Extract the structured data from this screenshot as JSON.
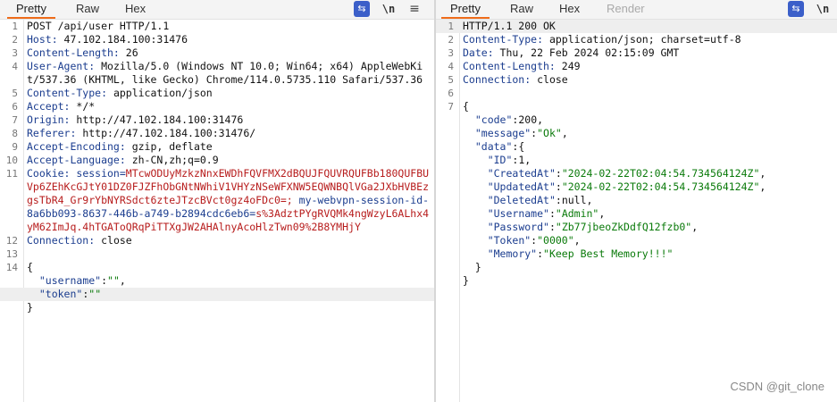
{
  "request": {
    "tabs": [
      "Pretty",
      "Raw",
      "Hex"
    ],
    "wrap_icon": "⇆",
    "newline_icon": "\\n",
    "menu_icon": "≡",
    "lines": [
      {
        "n": "1",
        "text": "POST /api/user HTTP/1.1"
      },
      {
        "n": "2",
        "k": "Host:",
        "v": " 47.102.184.100:31476"
      },
      {
        "n": "3",
        "k": "Content-Length:",
        "v": " 26"
      },
      {
        "n": "4",
        "k": "User-Agent:",
        "v": " Mozilla/5.0 (Windows NT 10.0; Win64; x64) AppleWebKit/537.36 (KHTML, like Gecko) Chrome/114.0.5735.110 Safari/537.36"
      },
      {
        "n": "5",
        "k": "Content-Type:",
        "v": " application/json"
      },
      {
        "n": "6",
        "k": "Accept:",
        "v": " */*"
      },
      {
        "n": "7",
        "k": "Origin:",
        "v": " http://47.102.184.100:31476"
      },
      {
        "n": "8",
        "k": "Referer:",
        "v": " http://47.102.184.100:31476/"
      },
      {
        "n": "9",
        "k": "Accept-Encoding:",
        "v": " gzip, deflate"
      },
      {
        "n": "10",
        "k": "Accept-Language:",
        "v": " zh-CN,zh;q=0.9"
      },
      {
        "n": "11",
        "cookie": true,
        "k": "Cookie:",
        "a": " session=",
        "b": "MTcwODUyMzkzNnxEWDhFQVFMX2dBQUJFQUVRQUFBb180QUFBUVp6ZEhKcGJtY01DZ0FJZFhObGNtNWhiV1VHYzNSeWFXNW5EQWNBQlVGa2JXbHVBEzgsTbR4_Gr9rYbNYRSdct6zteJTzcBVct0gz4oFDc0=;",
        "c": " my-webvpn-session-id-8a6bb093-8637-446b-a749-b2894cdc6eb6=",
        "d": "s%3AdztPYgRVQMk4ngWzyL6ALhx4yM62ImJq.4hTGAToQRqPiTTXgJW2AHAlnyAcoHlzTwn09%2B8YMHjY"
      },
      {
        "n": "12",
        "k": "Connection:",
        "v": " close"
      },
      {
        "n": "13",
        "text": ""
      },
      {
        "n": "14",
        "text": "{"
      },
      {
        "n": "",
        "jk": "  \"username\"",
        "jp": ":",
        "js": "\"\"",
        "je": ","
      },
      {
        "n": "",
        "jk": "  \"token\"",
        "jp": ":",
        "js": "\"\"",
        "je": "",
        "hl": true
      },
      {
        "n": "",
        "text": "}"
      }
    ]
  },
  "response": {
    "tabs": [
      "Pretty",
      "Raw",
      "Hex",
      "Render"
    ],
    "wrap_icon": "⇆",
    "newline_icon": "\\n",
    "lines": [
      {
        "n": "1",
        "text": "HTTP/1.1 200 OK",
        "hl": true
      },
      {
        "n": "2",
        "k": "Content-Type:",
        "v": " application/json; charset=utf-8"
      },
      {
        "n": "3",
        "k": "Date:",
        "v": " Thu, 22 Feb 2024 02:15:09 GMT"
      },
      {
        "n": "4",
        "k": "Content-Length:",
        "v": " 249"
      },
      {
        "n": "5",
        "k": "Connection:",
        "v": " close"
      },
      {
        "n": "6",
        "text": ""
      },
      {
        "n": "7",
        "text": "{"
      },
      {
        "n": "",
        "jk": "  \"code\"",
        "jp": ":",
        "jn": "200",
        "je": ","
      },
      {
        "n": "",
        "jk": "  \"message\"",
        "jp": ":",
        "js": "\"Ok\"",
        "je": ","
      },
      {
        "n": "",
        "jk": "  \"data\"",
        "jp": ":{",
        "je": ""
      },
      {
        "n": "",
        "jk": "    \"ID\"",
        "jp": ":",
        "jn": "1",
        "je": ","
      },
      {
        "n": "",
        "jk": "    \"CreatedAt\"",
        "jp": ":",
        "js": "\"2024-02-22T02:04:54.734564124Z\"",
        "je": ","
      },
      {
        "n": "",
        "jk": "    \"UpdatedAt\"",
        "jp": ":",
        "js": "\"2024-02-22T02:04:54.734564124Z\"",
        "je": ","
      },
      {
        "n": "",
        "jk": "    \"DeletedAt\"",
        "jp": ":",
        "jn": "null",
        "je": ","
      },
      {
        "n": "",
        "jk": "    \"Username\"",
        "jp": ":",
        "js": "\"Admin\"",
        "je": ","
      },
      {
        "n": "",
        "jk": "    \"Password\"",
        "jp": ":",
        "js": "\"Zb77jbeoZkDdfQ12fzb0\"",
        "je": ","
      },
      {
        "n": "",
        "jk": "    \"Token\"",
        "jp": ":",
        "js": "\"0000\"",
        "je": ","
      },
      {
        "n": "",
        "jk": "    \"Memory\"",
        "jp": ":",
        "js": "\"Keep Best Memory!!!\"",
        "je": ""
      },
      {
        "n": "",
        "text": "  }"
      },
      {
        "n": "",
        "text": "}"
      }
    ]
  },
  "watermark": "CSDN @git_clone"
}
